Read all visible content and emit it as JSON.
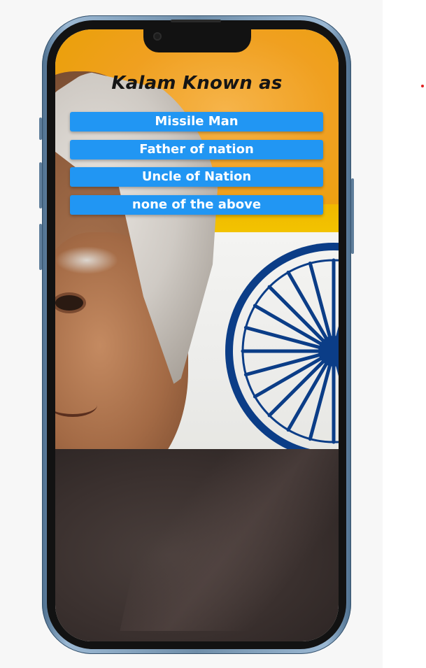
{
  "quiz": {
    "question": "Kalam Known as",
    "options": [
      {
        "label": "Missile Man"
      },
      {
        "label": "Father of nation"
      },
      {
        "label": "Uncle of Nation"
      },
      {
        "label": "none of the above"
      }
    ]
  },
  "colors": {
    "button_bg": "#2196f3",
    "button_text": "#ffffff",
    "title_text": "#151515",
    "phone_frame": "#6f8ea9",
    "flag_saffron": "#f0a020",
    "flag_white": "#f4f4f2",
    "flag_green": "#3a8a22",
    "chakra_blue": "#0b3d87",
    "indicator_dot": "#e02020"
  },
  "background_image": {
    "subject": "portrait over Indian flag"
  }
}
